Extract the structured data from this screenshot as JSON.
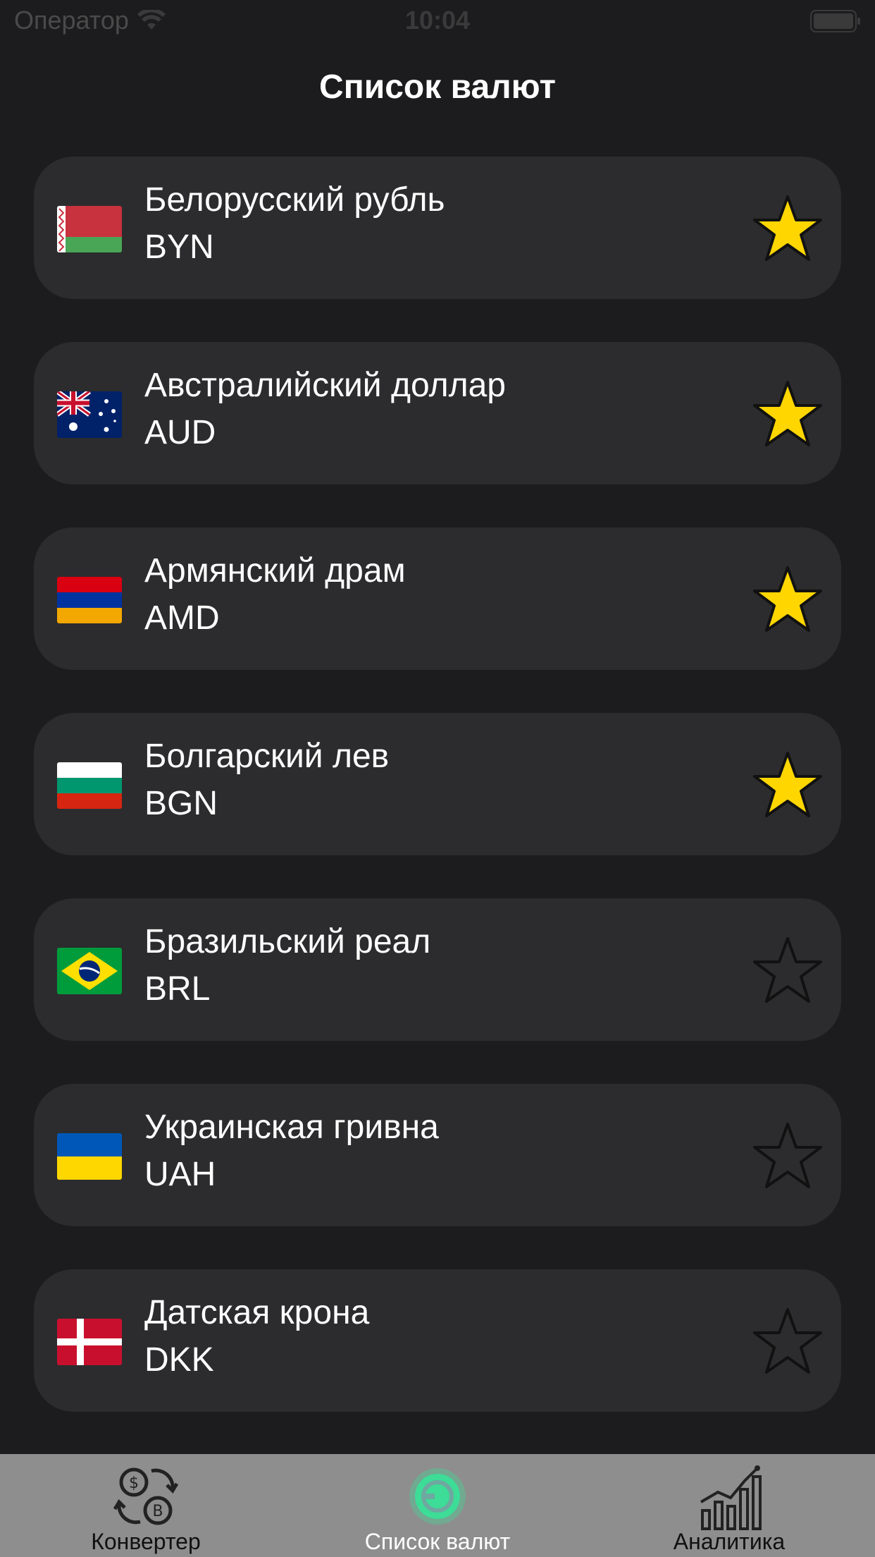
{
  "status_bar": {
    "carrier": "Оператор",
    "time": "10:04"
  },
  "nav": {
    "title": "Список валют"
  },
  "currencies": [
    {
      "name": "Белорусский рубль",
      "code": "BYN",
      "favorite": true,
      "flag": "belarus-flag"
    },
    {
      "name": "Австралийский доллар",
      "code": "AUD",
      "favorite": true,
      "flag": "australia-flag"
    },
    {
      "name": "Армянский драм",
      "code": "AMD",
      "favorite": true,
      "flag": "armenia-flag"
    },
    {
      "name": "Болгарский лев",
      "code": "BGN",
      "favorite": true,
      "flag": "bulgaria-flag"
    },
    {
      "name": "Бразильский реал",
      "code": "BRL",
      "favorite": false,
      "flag": "brazil-flag"
    },
    {
      "name": "Украинская гривна",
      "code": "UAH",
      "favorite": false,
      "flag": "ukraine-flag"
    },
    {
      "name": "Датская крона",
      "code": "DKK",
      "favorite": false,
      "flag": "denmark-flag"
    }
  ],
  "tabs": [
    {
      "label": "Конвертер",
      "icon": "exchange-icon",
      "active": false
    },
    {
      "label": "Список валют",
      "icon": "currency-list-icon",
      "active": true
    },
    {
      "label": "Аналитика",
      "icon": "analytics-chart-icon",
      "active": false
    }
  ],
  "colors": {
    "background": "#1c1c1e",
    "card": "#2c2c2e",
    "star_fill": "#ffd600",
    "tab_bar": "#8e8e8e",
    "active_tab": "#3ddc97"
  }
}
